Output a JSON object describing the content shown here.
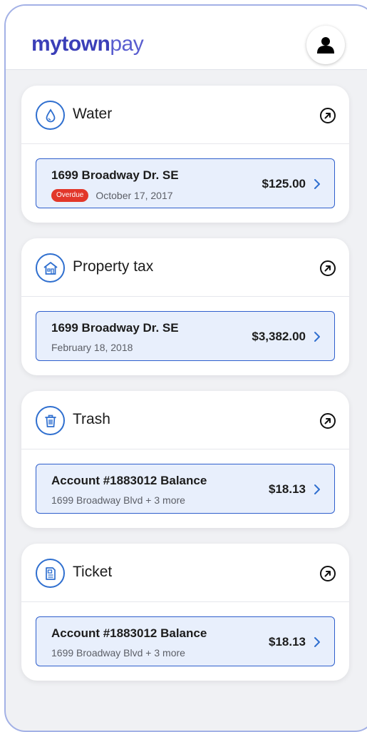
{
  "header": {
    "logo_bold": "mytown",
    "logo_light": "pay",
    "avatar_icon": "user-icon"
  },
  "colors": {
    "brand": "#3b3fb8",
    "accent": "#2f6fcf",
    "overdue": "#e2372a",
    "bill_bg": "#e8effc"
  },
  "cards": [
    {
      "title": "Water",
      "icon": "water-drop-icon",
      "bill": {
        "title": "1699 Broadway Dr. SE",
        "badge": "Overdue",
        "subtitle": "October 17, 2017",
        "amount": "$125.00"
      }
    },
    {
      "title": "Property tax",
      "icon": "house-icon",
      "bill": {
        "title": "1699 Broadway Dr. SE",
        "subtitle": "February 18, 2018",
        "amount": "$3,382.00"
      }
    },
    {
      "title": "Trash",
      "icon": "trash-icon",
      "bill": {
        "title": "Account #1883012 Balance",
        "subtitle": "1699 Broadway Blvd + 3 more",
        "amount": "$18.13"
      }
    },
    {
      "title": "Ticket",
      "icon": "ticket-document-icon",
      "bill": {
        "title": "Account #1883012 Balance",
        "subtitle": "1699 Broadway Blvd + 3 more",
        "amount": "$18.13"
      }
    }
  ]
}
